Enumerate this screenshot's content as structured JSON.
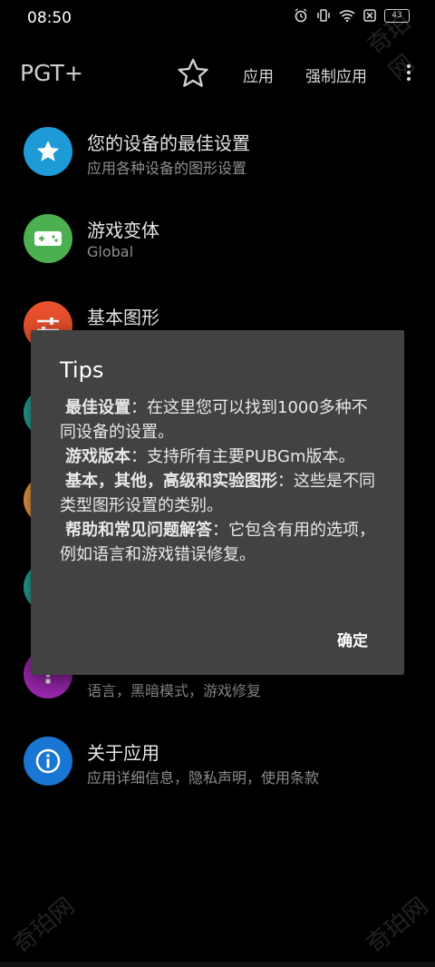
{
  "status_bar": {
    "time": "08:50",
    "battery": "43"
  },
  "toolbar": {
    "title": "PGT+",
    "apply": "应用",
    "force_apply": "强制应用"
  },
  "menu": {
    "items": [
      {
        "title": "您的设备的最佳设置",
        "subtitle": "应用各种设备的图形设置",
        "icon": "star-icon",
        "color": "#1e9ad6"
      },
      {
        "title": "游戏变体",
        "subtitle": "Global",
        "icon": "gamepad-icon",
        "color": "#4caf50"
      },
      {
        "title": "基本图形",
        "subtitle": "",
        "icon": "sliders-icon",
        "color": "#e6502c"
      },
      {
        "title": "",
        "subtitle": "语言，黑暗模式，游戏修复",
        "icon": "help-icon",
        "color": "#9c27b0"
      },
      {
        "title": "关于应用",
        "subtitle": "应用详细信息，隐私声明，使用条款",
        "icon": "info-icon",
        "color": "#1976d2"
      }
    ]
  },
  "dialog": {
    "title": "Tips",
    "lines": [
      {
        "bold": "最佳设置",
        "text": "：在这里您可以找到1000多种不同设备的设置。"
      },
      {
        "bold": "游戏版本",
        "text": "：支持所有主要PUBGm版本。"
      },
      {
        "bold": "基本，其他，高级和实验图形",
        "text": "：这些是不同类型图形设置的类别。"
      },
      {
        "bold": "帮助和常见问题解答",
        "text": "：它包含有用的选项，例如语言和游戏错误修复。"
      }
    ],
    "ok": "确定"
  },
  "watermark": "奇珀网"
}
